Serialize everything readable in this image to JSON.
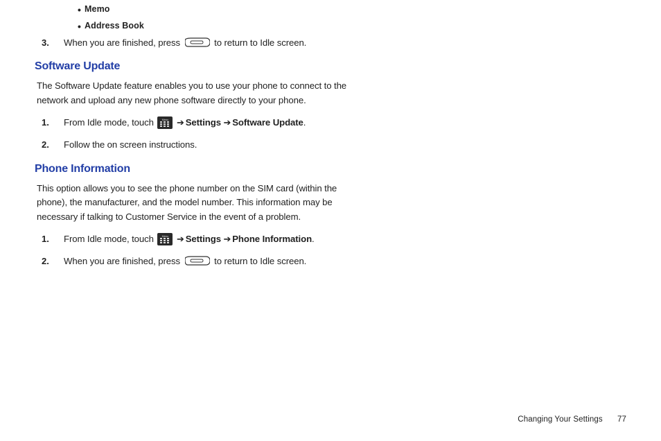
{
  "top_list": {
    "bullets": [
      "Memo",
      "Address Book"
    ],
    "item3": {
      "num": "3.",
      "text_before": "When you are finished, press ",
      "text_after": " to return to Idle screen."
    }
  },
  "software_update": {
    "heading": "Software Update",
    "body": "The Software Update feature enables you to use your phone to connect to the network and upload any new phone software directly to your phone.",
    "step1": {
      "num": "1.",
      "text_before": "From Idle mode, touch ",
      "arrow": " ➔ ",
      "settings": "Settings",
      "arrow2": " ➔ ",
      "target": "Software Update",
      "period": "."
    },
    "step2": {
      "num": "2.",
      "text": "Follow the on screen instructions."
    }
  },
  "phone_info": {
    "heading": "Phone Information",
    "body": "This option allows you to see the phone number on the SIM card (within the phone), the manufacturer, and the model number. This information may be necessary if talking to Customer Service in the event of a problem.",
    "step1": {
      "num": "1.",
      "text_before": "From Idle mode, touch ",
      "arrow": " ➔ ",
      "settings": "Settings",
      "arrow2": " ➔ ",
      "target": "Phone Information",
      "period": "."
    },
    "step2": {
      "num": "2.",
      "text_before": "When you are finished, press ",
      "text_after": " to return to Idle screen."
    }
  },
  "footer": {
    "label": "Changing Your Settings",
    "page": "77"
  }
}
